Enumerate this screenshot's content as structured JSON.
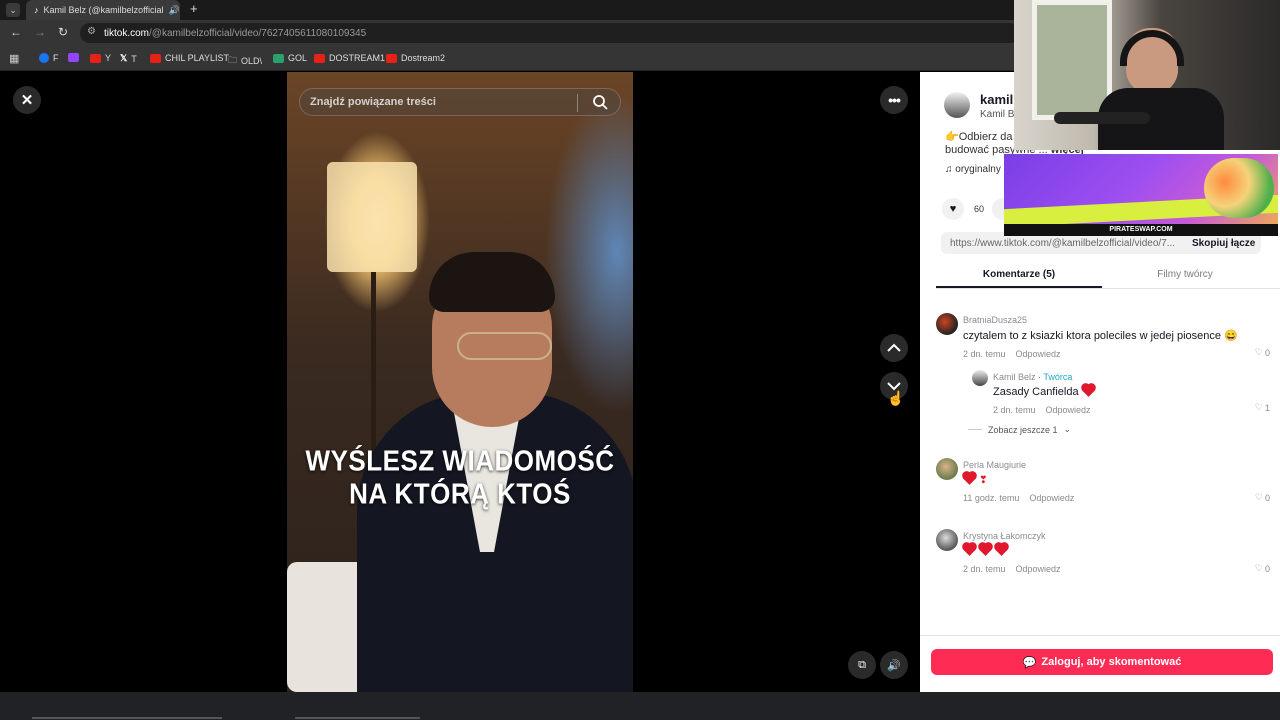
{
  "browser": {
    "tab_title": "Kamil Belz (@kamilbelzofficial",
    "url_host": "tiktok.com",
    "url_path": "/@kamilbelzofficial/video/7627405611080109345",
    "bookmarks": [
      "F",
      "Y",
      "T",
      "CHIL PLAYLIST",
      "OLD\\",
      "GOL",
      "DOSTREAM1",
      "Dostream2"
    ]
  },
  "video": {
    "search_placeholder": "Znajdź powiązane treści",
    "caption_line1": "WYŚLESZ WIADOMOŚĆ",
    "caption_line2": "NA KTÓRĄ KTOŚ"
  },
  "panel": {
    "author_handle": "kamilb",
    "author_name": "Kamil Be",
    "description_line1": "Odbierz da",
    "description_line2": "budować pasywne ...",
    "description_more": "więcej",
    "sound": "oryginalny",
    "likes": "60",
    "share_url": "https://www.tiktok.com/@kamilbelzofficial/video/7...",
    "copy_link": "Skopiuj łącze",
    "tab_comments": "Komentarze (5)",
    "tab_creator": "Filmy twórcy",
    "comments": [
      {
        "user": "BratniaDusza25",
        "text": "czytalem to z ksiazki ktora poleciles w jedej piosence 😄",
        "time": "2 dn. temu",
        "reply": "Odpowiedz",
        "likes": "0"
      },
      {
        "user": "Kamil Belz",
        "badge": "· Twórca",
        "text": "Zasady Canfielda",
        "time": "2 dn. temu",
        "reply": "Odpowiedz",
        "likes": "1"
      },
      {
        "user": "Perla Maugiurie",
        "text": "",
        "time": "11 godz. temu",
        "reply": "Odpowiedz",
        "likes": "0"
      },
      {
        "user": "Krystyna Łakomczyk",
        "text": "",
        "time": "2 dn. temu",
        "reply": "Odpowiedz",
        "likes": "0"
      }
    ],
    "see_more": "Zobacz jeszcze 1",
    "login_button": "Zaloguj, aby skomentować"
  },
  "ad": {
    "text": "PIRATESWAP.COM"
  },
  "colors": {
    "accent": "#fe2c55",
    "creator_badge": "#20d5ec"
  }
}
